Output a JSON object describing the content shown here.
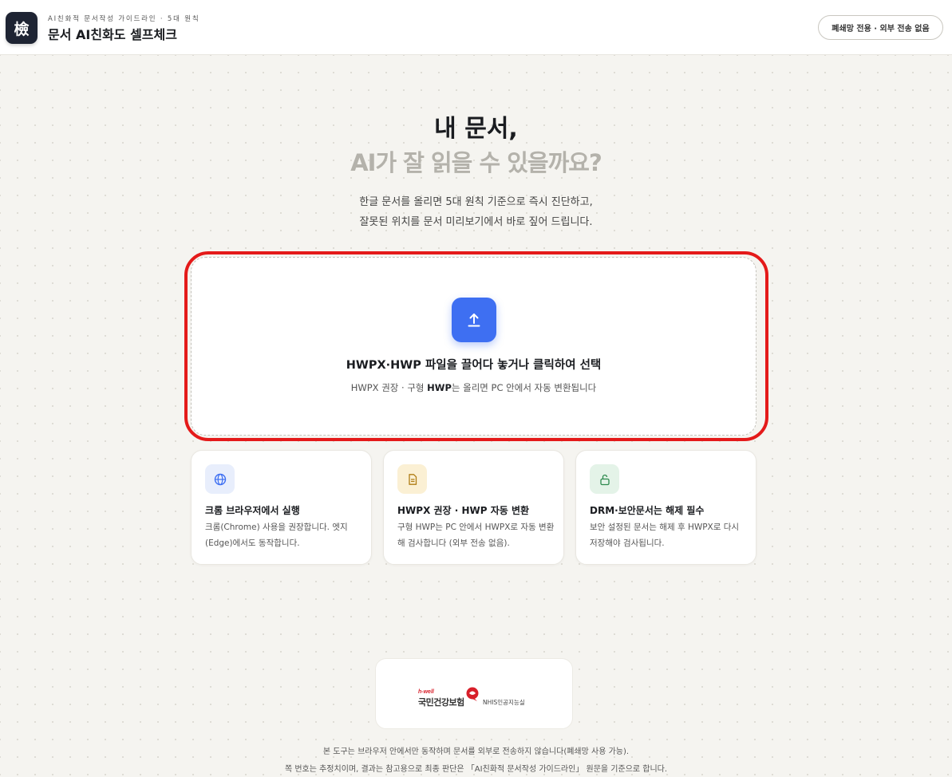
{
  "header": {
    "logo_char": "檢",
    "subtitle": "AI친화적 문서작성 가이드라인 · 5대 원칙",
    "title": "문서 AI친화도 셀프체크",
    "badge": "폐쇄망 전용 · 외부 전송 없음"
  },
  "hero": {
    "title_line1": "내 문서,",
    "title_line2": "AI가 잘 읽을 수 있을까요?",
    "desc_line1": "한글 문서를 올리면 5대 원칙 기준으로 즉시 진단하고,",
    "desc_line2": "잘못된 위치를 문서 미리보기에서 바로 짚어 드립니다."
  },
  "upload": {
    "icon": "upload-icon",
    "title": "HWPX·HWP 파일을 끌어다 놓거나 클릭하여 선택",
    "hint_prefix": "HWPX 권장 · 구형 ",
    "hint_bold": "HWP",
    "hint_suffix": "는 올리면 PC 안에서 자동 변환됩니다",
    "accent_color": "#3e6ff2",
    "highlight_color": "#e41a1a"
  },
  "cards": [
    {
      "icon": "globe-icon",
      "title": "크롬 브라우저에서 실행",
      "body": "크롬(Chrome) 사용을 권장합니다. 엣지(Edge)에서도 동작합니다."
    },
    {
      "icon": "document-icon",
      "title": "HWPX 권장 · HWP 자동 변환",
      "body": "구형 HWP는 PC 안에서 HWPX로 자동 변환해 검사합니다 (외부 전송 없음)."
    },
    {
      "icon": "unlock-icon",
      "title": "DRM·보안문서는 해제 필수",
      "body": "보안 설정된 문서는 해제 후 HWPX로 다시 저장해야 검사됩니다."
    }
  ],
  "partner": {
    "hwell": "h-well",
    "name": "국민건강보험",
    "lab": "NHIS인공지능실"
  },
  "footer": {
    "line1": "본 도구는 브라우저 안에서만 동작하며 문서를 외부로 전송하지 않습니다(폐쇄망 사용 가능).",
    "line2": "쪽 번호는 추정치이며, 결과는 참고용으로 최종 판단은 「AI친화적 문서작성 가이드라인」 원문을 기준으로 합니다."
  }
}
